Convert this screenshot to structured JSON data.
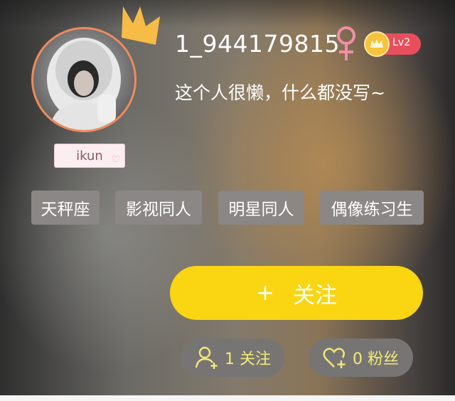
{
  "profile": {
    "username": "1_944179815",
    "gender_symbol": "♀",
    "level": "Lv2",
    "bio": "这个人很懒，什么都没写~",
    "badge": "ikun"
  },
  "tags": [
    "天秤座",
    "影视同人",
    "明星同人",
    "偶像练习生"
  ],
  "actions": {
    "follow_plus": "+",
    "follow_label": "关注"
  },
  "stats": {
    "following": "1 关注",
    "followers": "0 粉丝"
  },
  "colors": {
    "accent_yellow": "#f9d512",
    "avatar_border": "#f08a5d",
    "level_red": "#e84f5c",
    "gender_pink": "#f08fa6",
    "stat_text": "#f3e97a"
  },
  "icons": [
    "crown-icon",
    "female-icon",
    "level-crown-icon",
    "heart-icon",
    "add-user-icon",
    "heart-plus-icon"
  ]
}
